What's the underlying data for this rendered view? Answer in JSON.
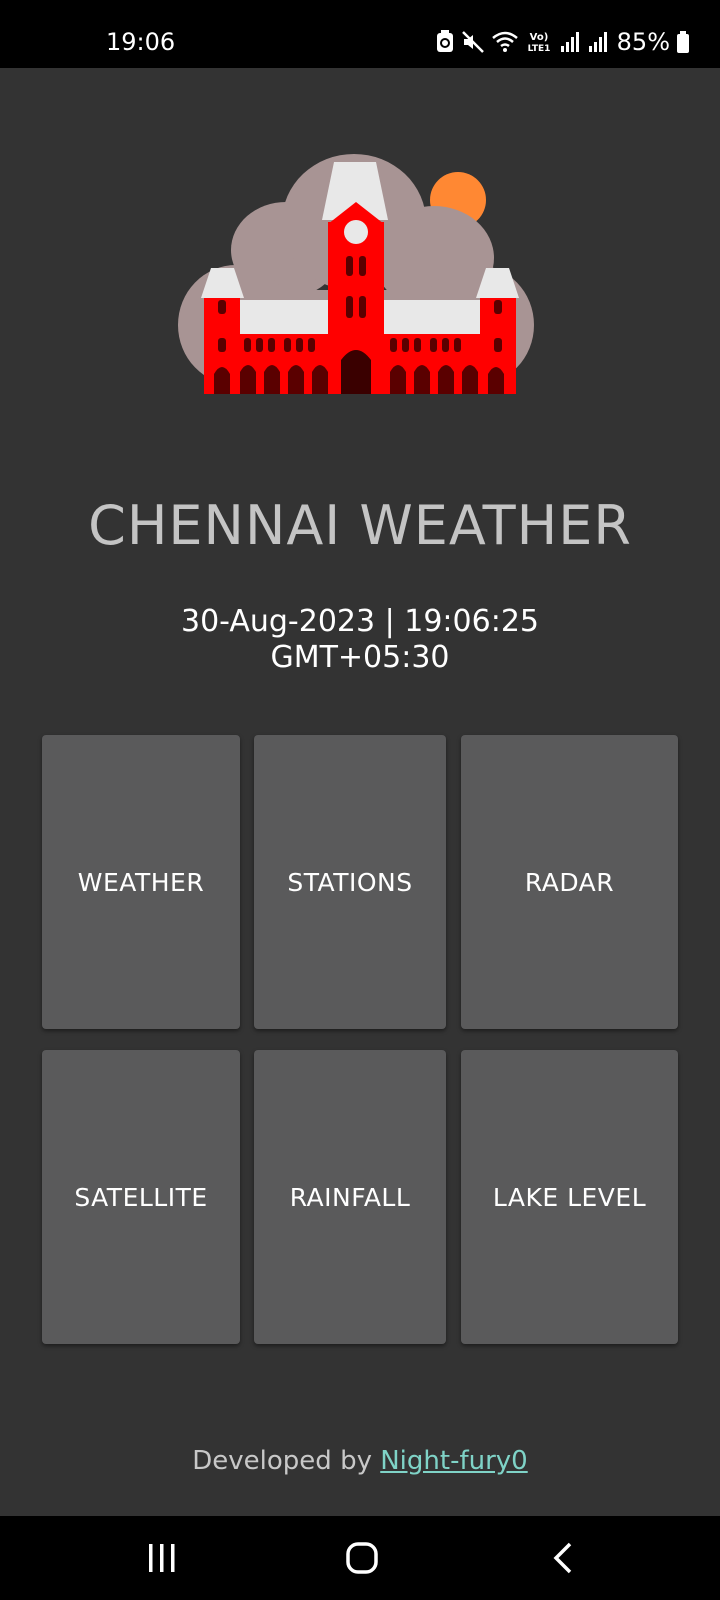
{
  "status_bar": {
    "time": "19:06",
    "battery_percent": "85%",
    "network_label": "Vo) LTE1",
    "icons": [
      "recycle-notification-icon",
      "mute-icon",
      "wifi-icon",
      "volte-icon",
      "signal-icon",
      "signal-icon",
      "battery-icon"
    ]
  },
  "app": {
    "title": "CHENNAI WEATHER",
    "datetime_line1": "30-Aug-2023 | 19:06:25",
    "datetime_line2": "GMT+05:30",
    "logo": "chennai-central-building-cloud-sun-logo"
  },
  "tiles": [
    {
      "label": "WEATHER"
    },
    {
      "label": "STATIONS"
    },
    {
      "label": "RADAR"
    },
    {
      "label": "SATELLITE"
    },
    {
      "label": "RAINFALL"
    },
    {
      "label": "LAKE LEVEL"
    }
  ],
  "footer": {
    "prefix": "Developed by",
    "link_text": "Night-fury0"
  },
  "nav_bar": {
    "buttons": [
      "recent-apps",
      "home",
      "back"
    ]
  },
  "colors": {
    "background": "#333333",
    "tile": "#5a5a5b",
    "title": "#c4c4c4",
    "link": "#7fd3c7",
    "building_red": "#ff0000",
    "cloud": "#a89494",
    "sun": "#ff8833"
  }
}
